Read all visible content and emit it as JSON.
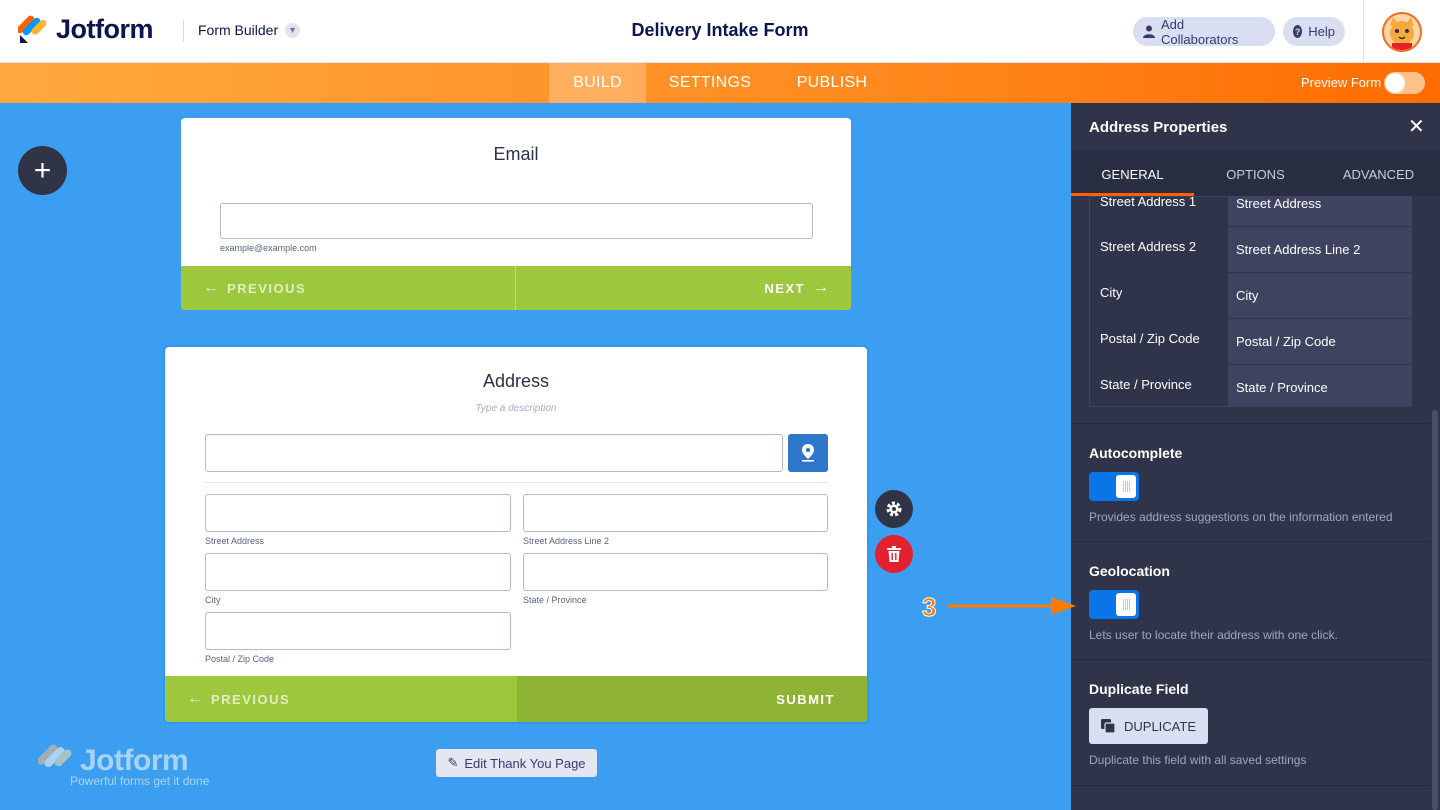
{
  "header": {
    "brand": "Jotform",
    "builder_label": "Form Builder",
    "form_title": "Delivery Intake Form",
    "collab_label": "Add Collaborators",
    "help_label": "Help"
  },
  "nav": {
    "tabs": [
      "BUILD",
      "SETTINGS",
      "PUBLISH"
    ],
    "active_tab": "BUILD",
    "preview_label": "Preview Form",
    "preview_on": false
  },
  "email_card": {
    "title": "Email",
    "sublabel": "example@example.com",
    "prev_label": "PREVIOUS",
    "next_label": "NEXT"
  },
  "address_card": {
    "title": "Address",
    "description_placeholder": "Type a description",
    "sublabels": {
      "street": "Street Address",
      "street2": "Street Address Line 2",
      "city": "City",
      "state": "State / Province",
      "zip": "Postal / Zip Code"
    },
    "prev_label": "PREVIOUS",
    "submit_label": "SUBMIT"
  },
  "thankyou_label": "Edit Thank You Page",
  "watermark": {
    "brand": "Jotform",
    "tagline": "Powerful forms get it done"
  },
  "panel": {
    "title": "Address Properties",
    "tabs": [
      "GENERAL",
      "OPTIONS",
      "ADVANCED"
    ],
    "active_tab": "GENERAL",
    "sublabel_rows": [
      {
        "field": "Street Address 1",
        "label": "Street Address"
      },
      {
        "field": "Street Address 2",
        "label": "Street Address Line 2"
      },
      {
        "field": "City",
        "label": "City"
      },
      {
        "field": "Postal / Zip Code",
        "label": "Postal / Zip Code"
      },
      {
        "field": "State / Province",
        "label": "State / Province"
      }
    ],
    "autocomplete": {
      "title": "Autocomplete",
      "on": true,
      "desc": "Provides address suggestions on the information entered"
    },
    "geolocation": {
      "title": "Geolocation",
      "on": true,
      "desc": "Lets user to locate their address with one click."
    },
    "duplicate": {
      "title": "Duplicate Field",
      "button": "DUPLICATE",
      "desc": "Duplicate this field with all saved settings"
    }
  },
  "annotation": {
    "step": "3"
  },
  "colors": {
    "canvas": "#3c9ef0",
    "nav_orange": "#ff8a1f",
    "form_green": "#9dc73c",
    "panel_dark": "#30344a",
    "toggle_blue": "#0a75e8",
    "accent_orange": "#ff6100"
  }
}
